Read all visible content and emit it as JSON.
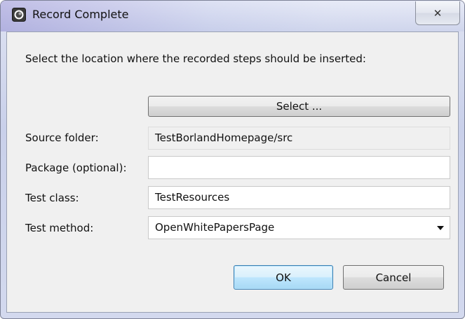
{
  "window": {
    "title": "Record Complete",
    "close_glyph": "✕",
    "title_icon": "eclipse-app-icon",
    "accent": "#3c7fb1"
  },
  "instruction": "Select the location where the recorded steps should be inserted:",
  "select_button": "Select ...",
  "fields": {
    "source_folder": {
      "label": "Source folder:",
      "value": "TestBorlandHomepage/src"
    },
    "package": {
      "label": "Package (optional):",
      "value": ""
    },
    "test_class": {
      "label": "Test class:",
      "value": "TestResources"
    },
    "test_method": {
      "label": "Test method:",
      "value": "OpenWhitePapersPage"
    }
  },
  "buttons": {
    "ok": "OK",
    "cancel": "Cancel"
  }
}
